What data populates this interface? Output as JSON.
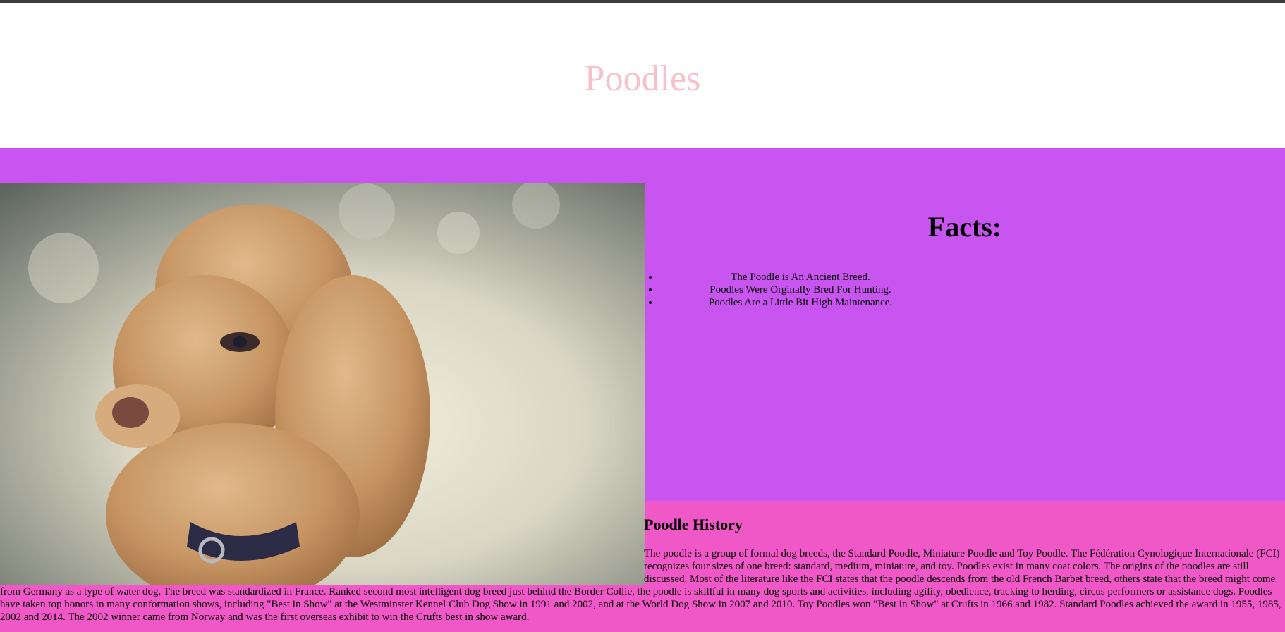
{
  "header": {
    "title": "Poodles"
  },
  "photo": {
    "alt": "poodle-photo"
  },
  "facts": {
    "title": "Facts:",
    "items": [
      "The Poodle is An Ancient Breed.",
      "Poodles Were Orginally Bred For Hunting.",
      "Poodles Are a Little Bit High Maintenance."
    ]
  },
  "history": {
    "title": "Poodle History",
    "text": "The poodle is a group of formal dog breeds, the Standard Poodle, Miniature Poodle and Toy Poodle. The Fédération Cynologique Internationale (FCI) recognizes four sizes of one breed: standard, medium, miniature, and toy. Poodles exist in many coat colors. The origins of the poodles are still discussed. Most of the literature like the FCI states that the poodle descends from the old French Barbet breed, others state that the breed might come from Germany as a type of water dog. The breed was standardized in France. Ranked second most intelligent dog breed just behind the Border Collie, the poodle is skillful in many dog sports and activities, including agility, obedience, tracking to herding, circus performers or assistance dogs. Poodles have taken top honors in many conformation shows, including \"Best in Show\" at the Westminster Kennel Club Dog Show in 1991 and 2002, and at the World Dog Show in 2007 and 2010. Toy Poodles won \"Best in Show\" at Crufts in 1966 and 1982. Standard Poodles achieved the award in 1955, 1985, 2002 and 2014. The 2002 winner came from Norway and was the first overseas exhibit to win the Crufts best in show award."
  },
  "colors": {
    "title": "#f7c1cc",
    "facts_bg": "#c855f0",
    "history_bg": "#f058c8",
    "topbar": "#3d3f3a"
  }
}
